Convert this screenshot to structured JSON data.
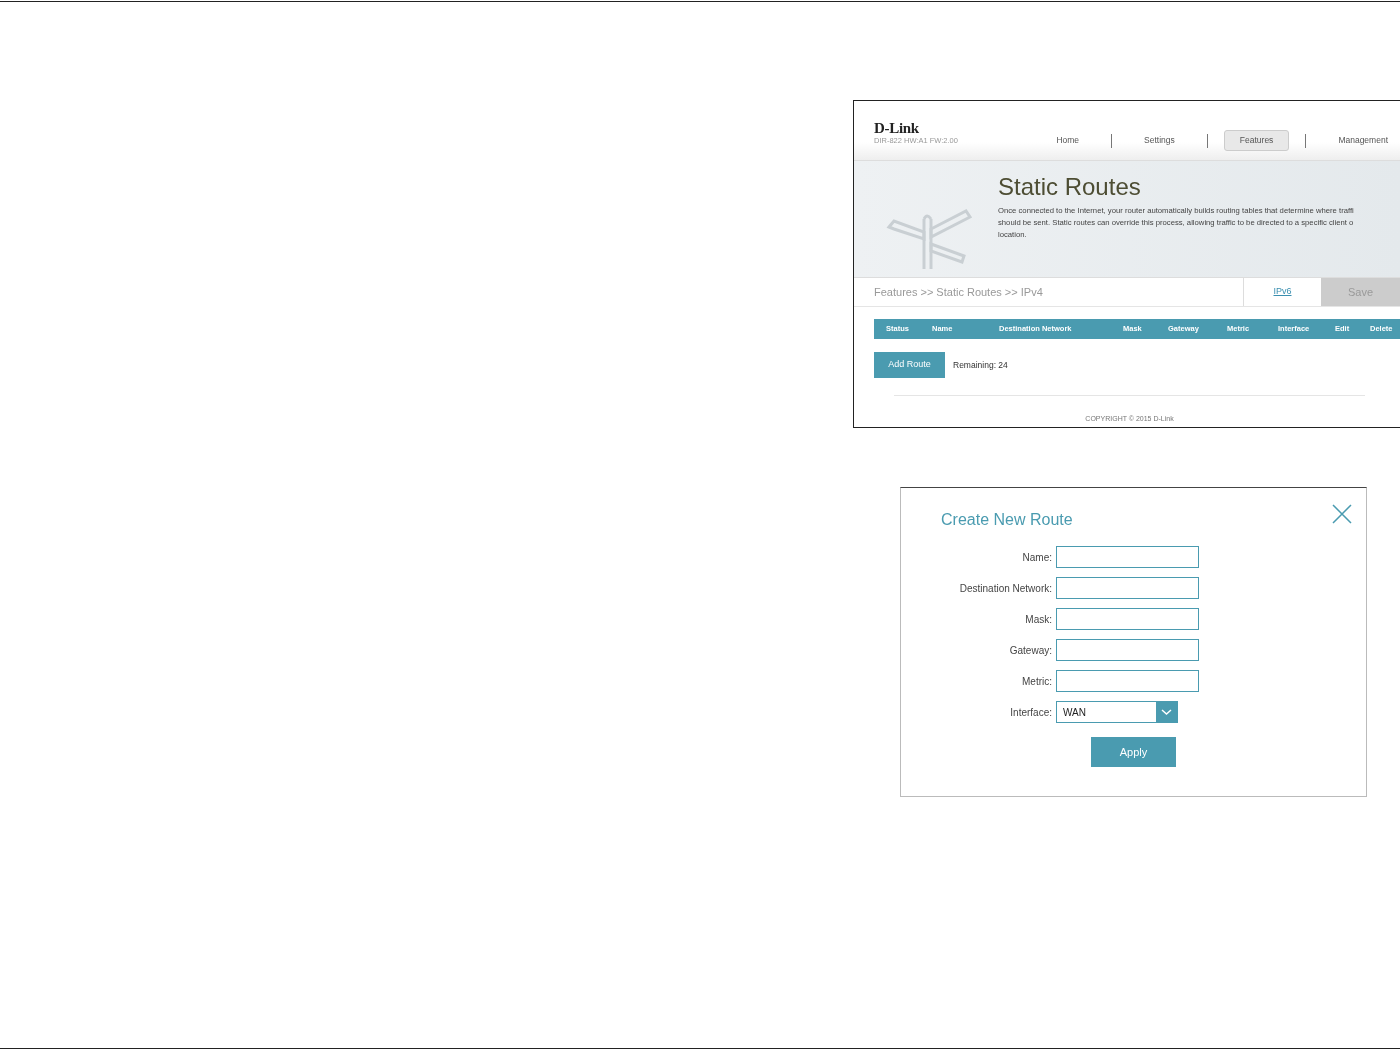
{
  "router_page": {
    "logo": "D-Link",
    "model": "DIR-822 HW:A1 FW:2.00",
    "nav": [
      {
        "label": "Home",
        "selected": false
      },
      {
        "label": "Settings",
        "selected": false
      },
      {
        "label": "Features",
        "selected": true
      },
      {
        "label": "Management",
        "selected": false
      }
    ],
    "title": "Static Routes",
    "description_lines": [
      "Once connected to the Internet, your router automatically builds routing tables that determine where traffi",
      "should be sent. Static routes can override this process, allowing traffic to be directed to a specific client o",
      "location."
    ],
    "breadcrumb": "Features >> Static Routes >> IPv4",
    "ipv6_link": "IPv6",
    "save_button": {
      "label": "Save",
      "disabled": true
    },
    "table": {
      "columns": [
        "Status",
        "Name",
        "Destination Network",
        "Mask",
        "Gateway",
        "Metric",
        "Interface",
        "Edit",
        "Delete"
      ]
    },
    "add_button": "Add Route",
    "remaining": "Remaining: 24",
    "copyright": "COPYRIGHT © 2015 D-Link"
  },
  "dialog": {
    "title": "Create New Route",
    "fields": [
      {
        "label": "Name:",
        "kind": "text"
      },
      {
        "label": "Destination Network:",
        "kind": "text"
      },
      {
        "label": "Mask:",
        "kind": "text"
      },
      {
        "label": "Gateway:",
        "kind": "text"
      },
      {
        "label": "Metric:",
        "kind": "text"
      },
      {
        "label": "Interface:",
        "kind": "select",
        "value": "WAN"
      }
    ],
    "apply_button": "Apply"
  }
}
